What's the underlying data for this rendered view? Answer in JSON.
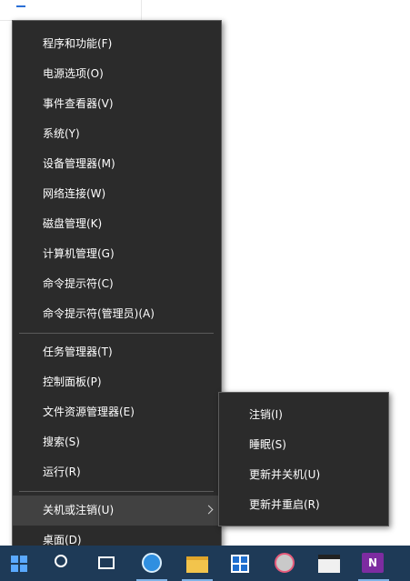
{
  "background_window": {
    "text": "..."
  },
  "menu": {
    "items": [
      {
        "label": "程序和功能(F)"
      },
      {
        "label": "电源选项(O)"
      },
      {
        "label": "事件查看器(V)"
      },
      {
        "label": "系统(Y)"
      },
      {
        "label": "设备管理器(M)"
      },
      {
        "label": "网络连接(W)"
      },
      {
        "label": "磁盘管理(K)"
      },
      {
        "label": "计算机管理(G)"
      },
      {
        "label": "命令提示符(C)"
      },
      {
        "label": "命令提示符(管理员)(A)"
      },
      {
        "label": "任务管理器(T)"
      },
      {
        "label": "控制面板(P)"
      },
      {
        "label": "文件资源管理器(E)"
      },
      {
        "label": "搜索(S)"
      },
      {
        "label": "运行(R)"
      },
      {
        "label": "关机或注销(U)"
      },
      {
        "label": "桌面(D)"
      }
    ],
    "highlighted_index": 15
  },
  "submenu": {
    "items": [
      {
        "label": "注销(I)"
      },
      {
        "label": "睡眠(S)"
      },
      {
        "label": "更新并关机(U)"
      },
      {
        "label": "更新并重启(R)"
      }
    ]
  },
  "taskbar": {
    "icons": [
      "start-icon",
      "search-icon",
      "task-view-icon",
      "browser-icon",
      "file-explorer-icon",
      "store-icon",
      "tool-icon",
      "clapper-icon",
      "onenote-icon"
    ],
    "onenote_glyph": "N",
    "accent": "#1e3a57"
  },
  "colors": {
    "menu_bg": "#2b2b2b",
    "menu_highlight": "#414141",
    "menu_text": "#ffffff"
  }
}
